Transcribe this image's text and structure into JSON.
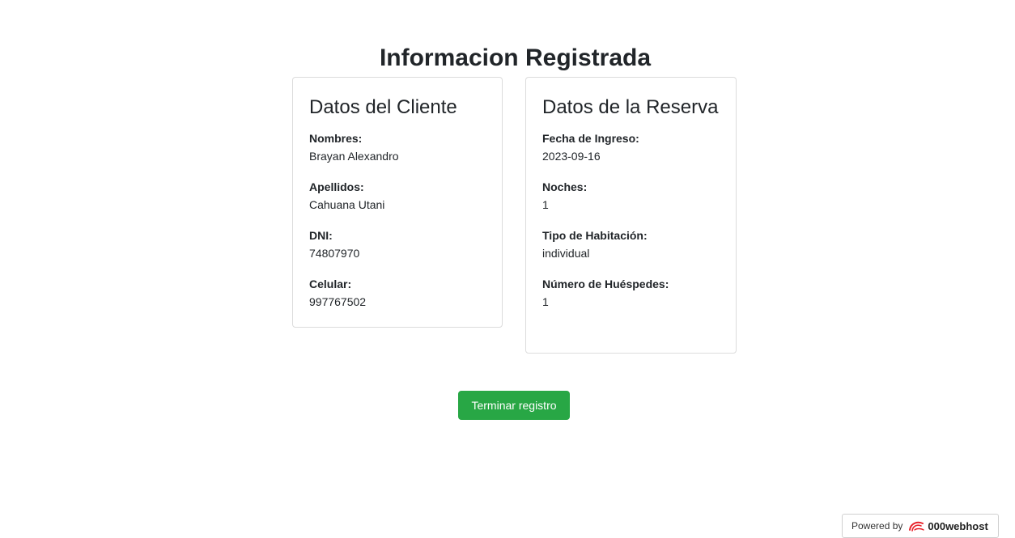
{
  "page": {
    "title": "Informacion Registrada"
  },
  "client_card": {
    "title": "Datos del Cliente",
    "fields": [
      {
        "label": "Nombres:",
        "value": "Brayan Alexandro"
      },
      {
        "label": "Apellidos:",
        "value": "Cahuana Utani"
      },
      {
        "label": "DNI:",
        "value": "74807970"
      },
      {
        "label": "Celular:",
        "value": "997767502"
      }
    ]
  },
  "reservation_card": {
    "title": "Datos de la Reserva",
    "fields": [
      {
        "label": "Fecha de Ingreso:",
        "value": "2023-09-16"
      },
      {
        "label": "Noches:",
        "value": "1"
      },
      {
        "label": "Tipo de Habitación:",
        "value": "individual"
      },
      {
        "label": "Número de Huéspedes:",
        "value": "1"
      }
    ]
  },
  "actions": {
    "finish_label": "Terminar registro",
    "finish_color": "#28a745"
  },
  "footer": {
    "powered_prefix": "Powered by",
    "powered_brand": "000webhost",
    "logo_icon": "000webhost-swirl-icon",
    "logo_color": "#e8212a"
  }
}
